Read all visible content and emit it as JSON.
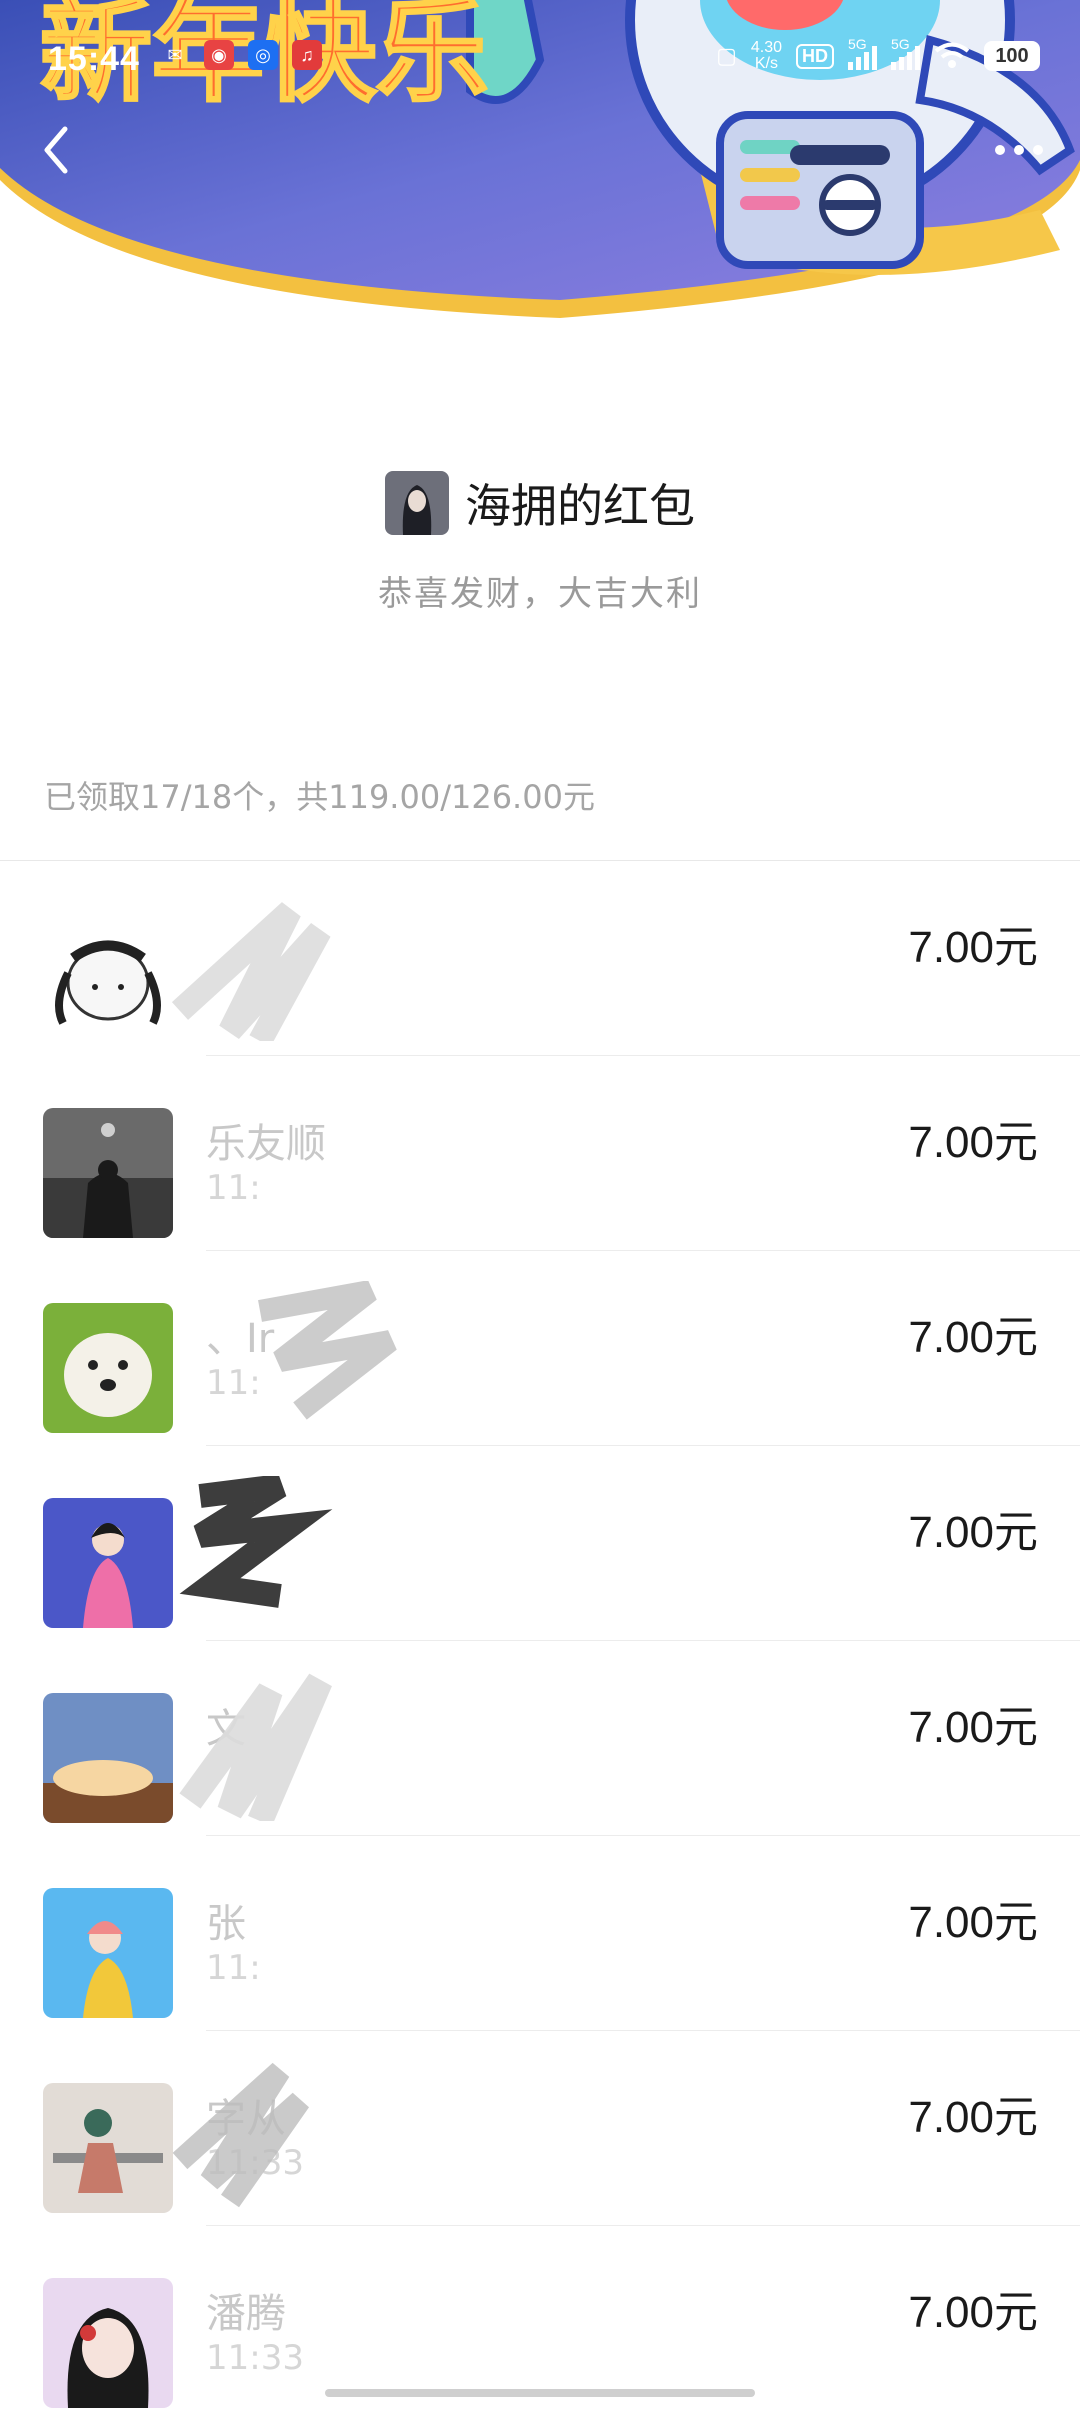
{
  "status_bar": {
    "time": "15:44",
    "net_speed_top": "4.30",
    "net_speed_bottom": "K/s",
    "hd_label": "HD",
    "signal_1_label": "5G",
    "signal_2_label": "5G",
    "battery": "100"
  },
  "banner": {
    "headline": "新年快乐"
  },
  "nav": {
    "back_icon": "chevron-left-icon",
    "more_icon": "ellipsis-icon"
  },
  "packet": {
    "title": "海拥的红包",
    "blessing": "恭喜发财，大吉大利",
    "summary": "已领取17/18个，共119.00/126.00元"
  },
  "receivers": [
    {
      "name": "",
      "time": "",
      "amount": "7.00元",
      "avatar_color": "#f2f2f2"
    },
    {
      "name": "乐友顺",
      "time": "11:",
      "amount": "7.00元",
      "avatar_color": "#555555"
    },
    {
      "name": "、Ir",
      "time": "11:",
      "amount": "7.00元",
      "avatar_color": "#8fbf4a"
    },
    {
      "name": "",
      "time": "",
      "amount": "7.00元",
      "avatar_color": "#4b57c8"
    },
    {
      "name": "文",
      "time": "",
      "amount": "7.00元",
      "avatar_color": "#5a7fb4"
    },
    {
      "name": "张",
      "time": "11:",
      "amount": "7.00元",
      "avatar_color": "#5ab8f0"
    },
    {
      "name": "字从",
      "time": "11:33",
      "amount": "7.00元",
      "avatar_color": "#cfc9c4"
    },
    {
      "name": "潘腾",
      "time": "11:33",
      "amount": "7.00元",
      "avatar_color": "#e9d9f0"
    }
  ]
}
